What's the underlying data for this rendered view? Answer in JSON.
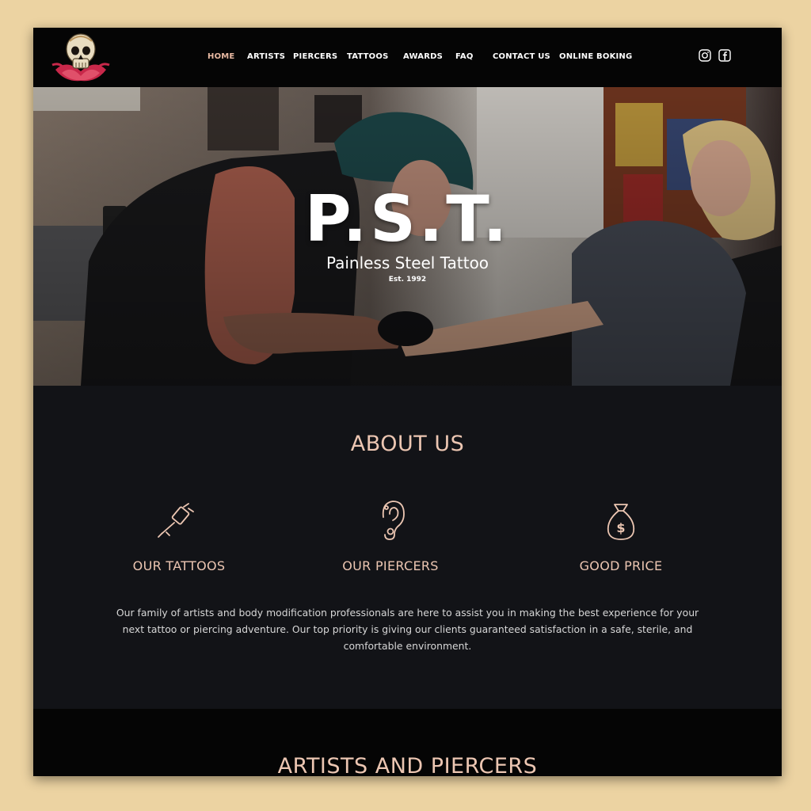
{
  "nav": {
    "items": [
      {
        "label": "HOME",
        "active": true
      },
      {
        "label": "ARTISTS"
      },
      {
        "label": "PIERCERS"
      },
      {
        "label": "TATTOOS"
      },
      {
        "label": "AWARDS"
      },
      {
        "label": "FAQ"
      },
      {
        "label": "CONTACT US"
      },
      {
        "label": "ONLINE BOKING"
      }
    ],
    "social": [
      {
        "icon": "instagram-icon"
      },
      {
        "icon": "facebook-icon"
      }
    ],
    "logo_icon": "skull-lotus-logo"
  },
  "hero": {
    "title": "P.S.T.",
    "subtitle": "Painless Steel Tattoo",
    "established": "Est. 1992"
  },
  "about": {
    "title": "ABOUT US",
    "features": [
      {
        "label": "OUR TATTOOS",
        "icon": "tattoo-machine-icon"
      },
      {
        "label": "OUR PIERCERS",
        "icon": "pierced-ear-icon"
      },
      {
        "label": "GOOD PRICE",
        "icon": "money-bag-icon"
      }
    ],
    "text": "Our family of artists and body modification professionals are here to assist you in making the best experience for your next tattoo or piercing adventure. Our top priority is giving our clients guaranteed satisfaction in a safe, sterile, and comfortable environment."
  },
  "artists": {
    "title": "ARTISTS AND PIERCERS"
  },
  "colors": {
    "accent": "#ecc6b2",
    "active_nav": "#e8b9a2",
    "page_bg": "#ecd3a2",
    "section_bg": "#121317",
    "header_bg": "#050505"
  }
}
